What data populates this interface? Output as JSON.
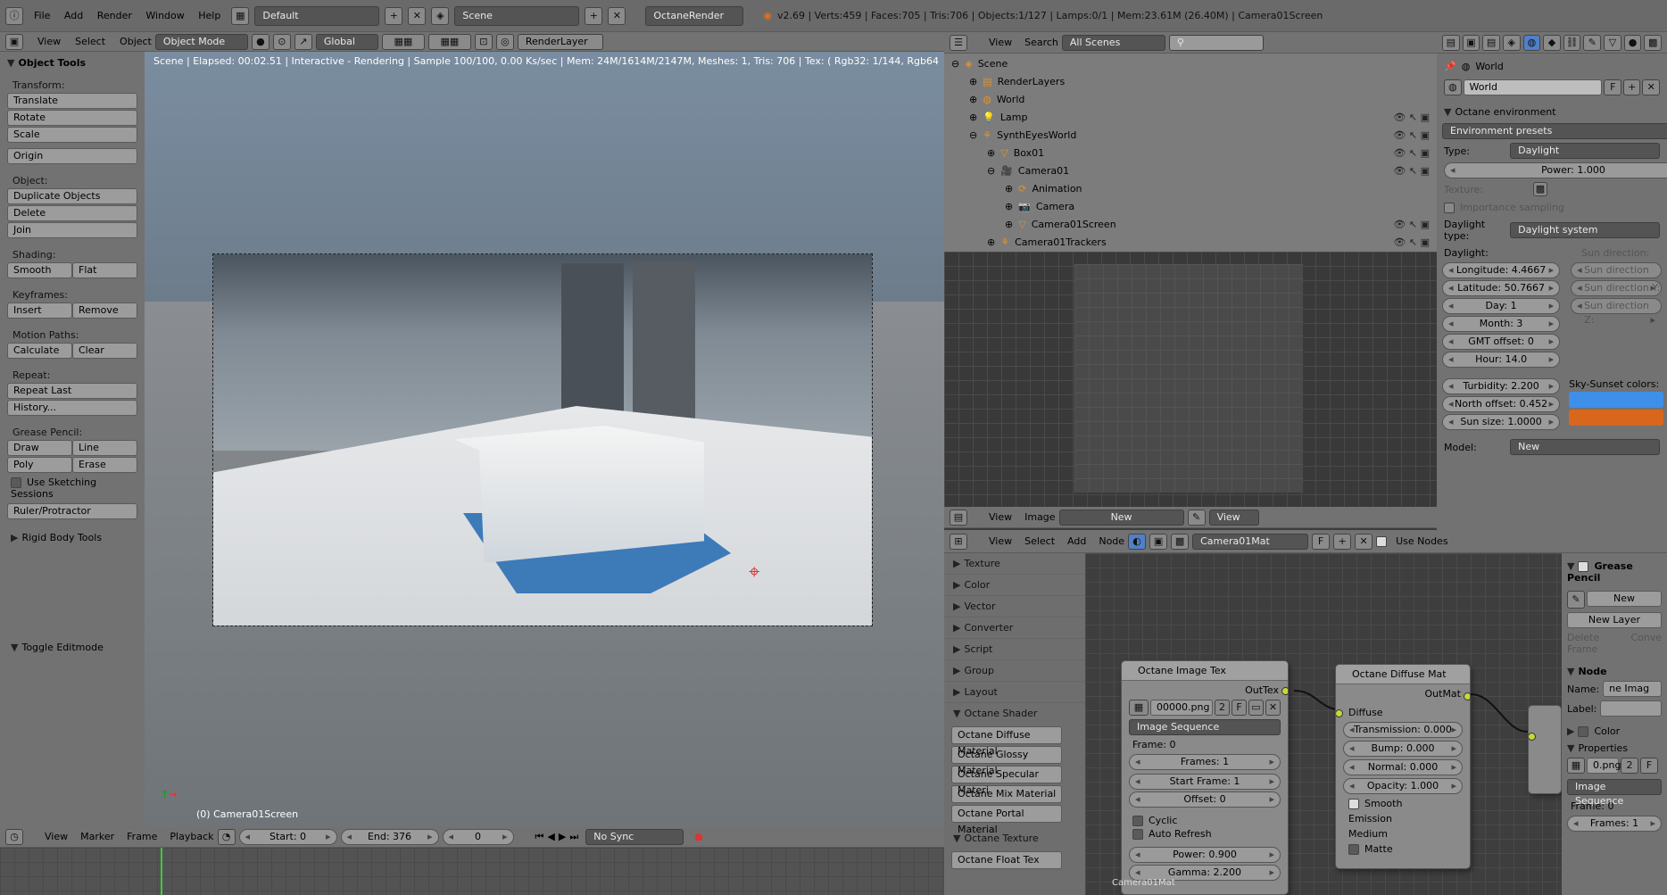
{
  "top": {
    "menu": [
      "File",
      "Add",
      "Render",
      "Window",
      "Help"
    ],
    "screen": "Default",
    "scene": "Scene",
    "engine": "OctaneRender",
    "stats": "v2.69 | Verts:459 | Faces:705 | Tris:706 | Objects:1/127 | Lamps:0/1 | Mem:23.61M (26.40M) | Camera01Screen"
  },
  "tools": {
    "title": "Object Tools",
    "transform": "Transform:",
    "translate": "Translate",
    "rotate": "Rotate",
    "scale": "Scale",
    "origin": "Origin",
    "object": "Object:",
    "duplicate": "Duplicate Objects",
    "delete": "Delete",
    "join": "Join",
    "shading": "Shading:",
    "smooth": "Smooth",
    "flat": "Flat",
    "keyframes": "Keyframes:",
    "insert": "Insert",
    "remove": "Remove",
    "motion": "Motion Paths:",
    "calculate": "Calculate",
    "clear": "Clear",
    "repeat": "Repeat:",
    "repeat_last": "Repeat Last",
    "history": "History...",
    "grease": "Grease Pencil:",
    "draw": "Draw",
    "line": "Line",
    "poly": "Poly",
    "erase": "Erase",
    "sketch": "Use Sketching Sessions",
    "ruler": "Ruler/Protractor",
    "rigid": "Rigid Body Tools",
    "toggle": "Toggle Editmode"
  },
  "vphead": {
    "view": "View",
    "select": "Select",
    "object": "Object",
    "mode": "Object Mode",
    "orientation": "Global",
    "renderlayer": "RenderLayer"
  },
  "viewport": {
    "status": "Scene | Elapsed: 00:02.51 | Interactive - Rendering | Sample 100/100, 0.00 Ks/sec | Mem: 24M/1614M/2147M, Meshes: 1, Tris: 706 | Tex: ( Rgb32: 1/144, Rgb64: 0/10, grey8: 0",
    "object_label": "(0) Camera01Screen"
  },
  "timeline": {
    "view": "View",
    "marker": "Marker",
    "frame": "Frame",
    "playback": "Playback",
    "start": "Start: 0",
    "end": "End: 376",
    "current": "0",
    "sync": "No Sync"
  },
  "outliner": {
    "view": "View",
    "search": "Search",
    "filter": "All Scenes",
    "rows": [
      {
        "label": "Scene",
        "indent": 0
      },
      {
        "label": "RenderLayers",
        "indent": 1
      },
      {
        "label": "World",
        "indent": 1
      },
      {
        "label": "Lamp",
        "indent": 1
      },
      {
        "label": "SynthEyesWorld",
        "indent": 1
      },
      {
        "label": "Box01",
        "indent": 2
      },
      {
        "label": "Camera01",
        "indent": 2
      },
      {
        "label": "Animation",
        "indent": 3
      },
      {
        "label": "Camera",
        "indent": 3
      },
      {
        "label": "Camera01Screen",
        "indent": 3
      },
      {
        "label": "Camera01Trackers",
        "indent": 2
      }
    ]
  },
  "imgedit": {
    "view": "View",
    "image": "Image",
    "new": "New",
    "view2": "View"
  },
  "props": {
    "context": "World",
    "world_name": "World",
    "f": "F",
    "section": "Octane environment",
    "presets": "Environment presets",
    "type_label": "Type:",
    "type": "Daylight",
    "power": "Power: 1.000",
    "texture": "Texture:",
    "importance": "Importance sampling",
    "daylight_type_label": "Daylight type:",
    "daylight_type": "Daylight system",
    "daylight": "Daylight:",
    "sun_direction": "Sun direction:",
    "longitude": "Longitude: 4.4667",
    "latitude": "Latitude: 50.7667",
    "day": "Day: 1",
    "month": "Month: 3",
    "gmt": "GMT offset: 0",
    "hour": "Hour: 14.0",
    "sunx": "Sun direction X:",
    "suny": "Sun direction Y:",
    "sunz": "Sun direction Z:",
    "turbidity": "Turbidity: 2.200",
    "north": "North offset: 0.452",
    "sunsize": "Sun size: 1.0000",
    "skysunset": "Sky-Sunset colors:",
    "model_label": "Model:",
    "model": "New",
    "sky_color": "#3d8fe8",
    "sunset_color": "#d8661c"
  },
  "nodehead": {
    "view": "View",
    "select": "Select",
    "add": "Add",
    "node": "Node",
    "material": "Camera01Mat",
    "f": "F",
    "use_nodes": "Use Nodes"
  },
  "nodelist": {
    "cats": [
      "Texture",
      "Color",
      "Vector",
      "Converter",
      "Script",
      "Group",
      "Layout"
    ],
    "octane_shader": "Octane Shader",
    "shaders": [
      "Octane Diffuse Material",
      "Octane Glossy Material",
      "Octane Specular Materi",
      "Octane Mix Material",
      "Octane Portal Material"
    ],
    "octane_texture": "Octane Texture",
    "textures": [
      "Octane Float Tex"
    ]
  },
  "node_imgtex": {
    "title": "Octane Image Tex",
    "out": "OutTex",
    "file": "00000.png",
    "users": "2",
    "f": "F",
    "source": "Image Sequence",
    "frame": "Frame: 0",
    "frames": "Frames: 1",
    "start": "Start Frame: 1",
    "offset": "Offset: 0",
    "cyclic": "Cyclic",
    "autorefresh": "Auto Refresh",
    "power": "Power: 0.900",
    "gamma": "Gamma: 2.200",
    "mat_label": "Camera01Mat"
  },
  "node_diffuse": {
    "title": "Octane Diffuse Mat",
    "out": "OutMat",
    "diffuse": "Diffuse",
    "transmission": "Transmission: 0.000",
    "bump": "Bump: 0.000",
    "normal": "Normal: 0.000",
    "opacity": "Opacity: 1.000",
    "smooth": "Smooth",
    "emission": "Emission",
    "medium": "Medium",
    "matte": "Matte"
  },
  "nside": {
    "grease": "Grease Pencil",
    "new": "New",
    "new_layer": "New Layer",
    "delete_frame": "Delete Frame",
    "convert": "Conve",
    "node": "Node",
    "name_label": "Name:",
    "name": "ne Imag",
    "label_label": "Label:",
    "color": "Color",
    "properties": "Properties",
    "file": "0.png",
    "users": "2",
    "f": "F",
    "source": "Image Sequence",
    "frame": "Frame: 0",
    "frames": "Frames: 1"
  }
}
